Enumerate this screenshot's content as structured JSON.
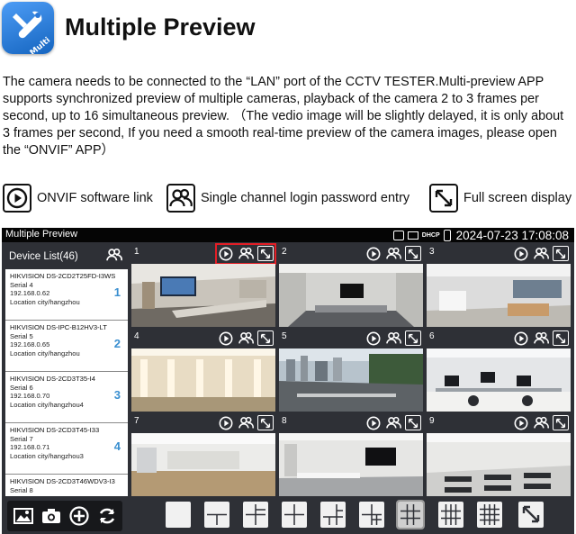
{
  "header": {
    "icon_badge": "Multi",
    "title": "Multiple Preview",
    "description": "The camera needs to be connected to the “LAN” port of the CCTV TESTER.Multi-preview APP supports synchronized preview of multiple cameras, playback of the camera 2 to 3 frames per second, up to 16 simultaneous preview.  （The vedio image will be slightly delayed, it is only about 3 frames per second,  If you need a smooth real-time preview of the camera images, please open the “ONVIF” APP）"
  },
  "legend": {
    "onvif_label": "ONVIF software link",
    "login_label": "Single channel login password entry",
    "fullscreen_label": "Full screen display"
  },
  "device": {
    "status_title": "Multiple Preview",
    "status_datetime": "2024-07-23 17:08:08",
    "status_dhcp": "DHCP",
    "device_list_title": "Device List(46)",
    "devices": [
      {
        "name": "HIKVISION DS-2CD2T25FD-I3WS",
        "serial": "Serial 4",
        "ip": "192.168.0.62",
        "location": "Location city/hangzhou",
        "index": "1"
      },
      {
        "name": "HIKVISION DS-IPC-B12HV3-LT",
        "serial": "Serial 5",
        "ip": "192.168.0.65",
        "location": "Location city/hangzhou",
        "index": "2"
      },
      {
        "name": "HIKVISION DS-2CD3T35-I4",
        "serial": "Serial 6",
        "ip": "192.168.0.70",
        "location": "Location city/hangzhou4",
        "index": "3"
      },
      {
        "name": "HIKVISION DS-2CD3T45-I33",
        "serial": "Serial 7",
        "ip": "192.168.0.71",
        "location": "Location city/hangzhou3",
        "index": "4"
      },
      {
        "name": "HIKVISION DS-2CD3T46WDV3-I3",
        "serial": "Serial 8",
        "ip": "",
        "location": "",
        "index": "5"
      }
    ],
    "cells": [
      {
        "num": "1",
        "scene": "conference-room"
      },
      {
        "num": "2",
        "scene": "meeting-room"
      },
      {
        "num": "3",
        "scene": "office-desks"
      },
      {
        "num": "4",
        "scene": "corridor"
      },
      {
        "num": "5",
        "scene": "city-view"
      },
      {
        "num": "6",
        "scene": "workstations"
      },
      {
        "num": "7",
        "scene": "empty-hall"
      },
      {
        "num": "8",
        "scene": "presentation-room"
      },
      {
        "num": "9",
        "scene": "training-room"
      }
    ],
    "bottom_left_icons": [
      "gallery-icon",
      "camera-icon",
      "add-icon",
      "refresh-icon"
    ],
    "layout_options": [
      "1",
      "2",
      "3",
      "4",
      "6",
      "7",
      "9",
      "12",
      "16"
    ],
    "active_layout": "9",
    "colors": {
      "accent": "#3a8fd0",
      "highlight": "#e41e26",
      "panel": "#2e3036"
    }
  }
}
